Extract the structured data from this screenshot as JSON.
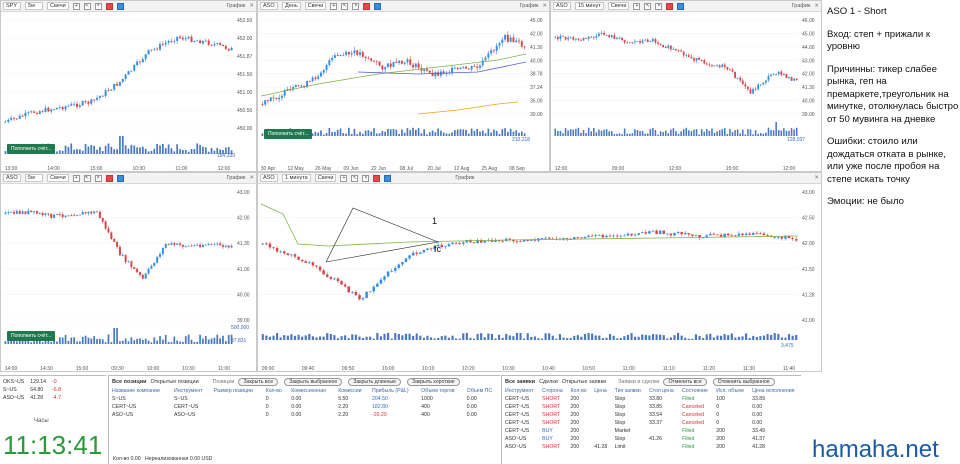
{
  "charts": [
    {
      "ticker": "SPY",
      "tf": "5м",
      "style": "Свечи",
      "label": "График",
      "prices": [
        "452.50",
        "452.00",
        "451.87",
        "451.50",
        "451.00",
        "450.50",
        "450.00"
      ],
      "times": [
        "13:00",
        "14:00",
        "15:00",
        "10:00",
        "11:00",
        "12:00"
      ],
      "volume": "184,339",
      "deposit": "Пополнить счёт..."
    },
    {
      "ticker": "ASO",
      "tf": "День",
      "style": "Свечи",
      "label": "График",
      "prices": [
        "45.00",
        "42.00",
        "41.30",
        "40.00",
        "38.78",
        "37.24",
        "35.00",
        "30.00"
      ],
      "times": [
        "30 Apr",
        "12 May",
        "26 May",
        "09 Jun",
        "22 Jun",
        "08 Jul",
        "20 Jul",
        "12 Aug",
        "25 Aug",
        "08 Sep"
      ],
      "volume": "210,218",
      "deposit": "Пополнить счёт..."
    },
    {
      "ticker": "ASO",
      "tf": "15 минут",
      "style": "Свечи",
      "label": "График",
      "prices": [
        "46.00",
        "45.00",
        "44.00",
        "43.00",
        "42.00",
        "41.30",
        "40.00",
        "39.00"
      ],
      "times": [
        "12:00",
        "09:00",
        "12:00",
        "15:00",
        "12:00"
      ],
      "volume": "128,037",
      "deposit": "Пополнить счёт..."
    },
    {
      "ticker": "ASO",
      "tf": "5м",
      "style": "Свечи",
      "label": "График",
      "prices": [
        "43.00",
        "42.00",
        "41.30",
        "41.00",
        "40.00",
        "39.00"
      ],
      "times": [
        "14:00",
        "14:30",
        "15:00",
        "09:30",
        "10:00",
        "10:30",
        "11:00"
      ],
      "volume": "37,831",
      "volume_top": "500,000",
      "deposit": "Пополнить счёт..."
    },
    {
      "ticker": "ASO",
      "tf": "1 минута",
      "style": "Свечи",
      "label": "График",
      "prices": [
        "43.00",
        "42.50",
        "42.00",
        "41.50",
        "41.28",
        "41.00"
      ],
      "times": [
        "09:00",
        "09:40",
        "09:50",
        "10:00",
        "10:10",
        "10:20",
        "10:30",
        "10:40",
        "10:50",
        "11:00",
        "11:10",
        "11:20",
        "11:30",
        "11:40"
      ],
      "volume": "3,475",
      "annot_1": "1",
      "annot_fc": "fc"
    }
  ],
  "note": {
    "title": "ASO 1 - Short",
    "entry": "Вход: степ + прижали к уровню",
    "reasons": "Причинны: тикер слабее рынка, геп на премаркете,треугольник на минутке, отолкнулась быстро от 50 мувинга на дневке",
    "mistakes": "Ошибки: стоило или дождаться отката в рынке, или уже после пробоя на степе искать точку",
    "emotions": "Эмоции: не было"
  },
  "watchlist": {
    "rows": [
      [
        "OKS~US",
        "129.14",
        "-0"
      ],
      [
        "S~US",
        "64.80",
        "-6.8"
      ],
      [
        "ASO~US",
        "41.28",
        "-4.7"
      ]
    ],
    "hours_label": "Часы"
  },
  "clock": "11:13:41",
  "positions": {
    "tabs": [
      "Все позиции",
      "Открытые позиции",
      "Позиции"
    ],
    "buttons": [
      "Закрыть все",
      "Закрыть выбранное",
      "Закрыть длинные",
      "Закрыть короткие"
    ],
    "headers": [
      "Название компании",
      "Инструмент",
      "Размер позиции",
      "Кол-во",
      "Комиссионная",
      "Комиссии",
      "Прибыль (P&L)",
      "Объем торгов",
      "Объем ПС"
    ],
    "rows": [
      [
        "S~US",
        "S~US",
        "",
        "0",
        "0.00",
        "5.50",
        "204.50",
        "1000",
        "0.00"
      ],
      [
        "CERT~US",
        "CERT~US",
        "",
        "0",
        "0.00",
        "2.20",
        "182.80",
        "400",
        "0.00"
      ],
      [
        "ASO~US",
        "ASO~US",
        "",
        "0",
        "0.00",
        "2.20",
        "-20.29",
        "400",
        "0.00"
      ]
    ],
    "footer_qty": "Кол-во",
    "footer_qty_val": "0.00",
    "footer_unreal": "Нереализованная",
    "footer_unreal_val": "0.00 USD"
  },
  "orders": {
    "tabs": [
      "Все заявки",
      "Сделки",
      "Открытые заявки"
    ],
    "section": "Заявки и сделки",
    "buttons": [
      "Отменить все",
      "Отменить выбранное"
    ],
    "headers": [
      "Инструмент",
      "Сторона",
      "Кол-во",
      "Цена",
      "Тип заявки",
      "Стоп цена",
      "Состояние",
      "Исп. объем",
      "Цена исполнения"
    ],
    "rows": [
      [
        "CERT~US",
        "SHORT",
        "200",
        "",
        "Stop",
        "33.80",
        "Filled",
        "100",
        "33.89"
      ],
      [
        "CERT~US",
        "SHORT",
        "200",
        "",
        "Stop",
        "33.85",
        "Canceled",
        "0",
        "0.00"
      ],
      [
        "CERT~US",
        "SHORT",
        "200",
        "",
        "Stop",
        "33.54",
        "Canceled",
        "0",
        "0.00"
      ],
      [
        "CERT~US",
        "SHORT",
        "200",
        "",
        "Stop",
        "33.37",
        "Canceled",
        "0",
        "0.00"
      ],
      [
        "CERT~US",
        "BUY",
        "200",
        "",
        "Market",
        "",
        "Filled",
        "200",
        "33.49"
      ],
      [
        "ASO~US",
        "BUY",
        "200",
        "",
        "Stop",
        "41.26",
        "Filled",
        "200",
        "41.37"
      ],
      [
        "ASO~US",
        "SHORT",
        "200",
        "41.28",
        "Limit",
        "",
        "Filled",
        "200",
        "41.28"
      ]
    ]
  },
  "watermark": "hamaha.net",
  "colors": {
    "up": "#3a8ee0",
    "down": "#d9464a",
    "ma_green": "#7cb342",
    "ma_blue": "#5560c8",
    "ma_orange": "#f0a020",
    "deposit": "#1e7a4e"
  }
}
